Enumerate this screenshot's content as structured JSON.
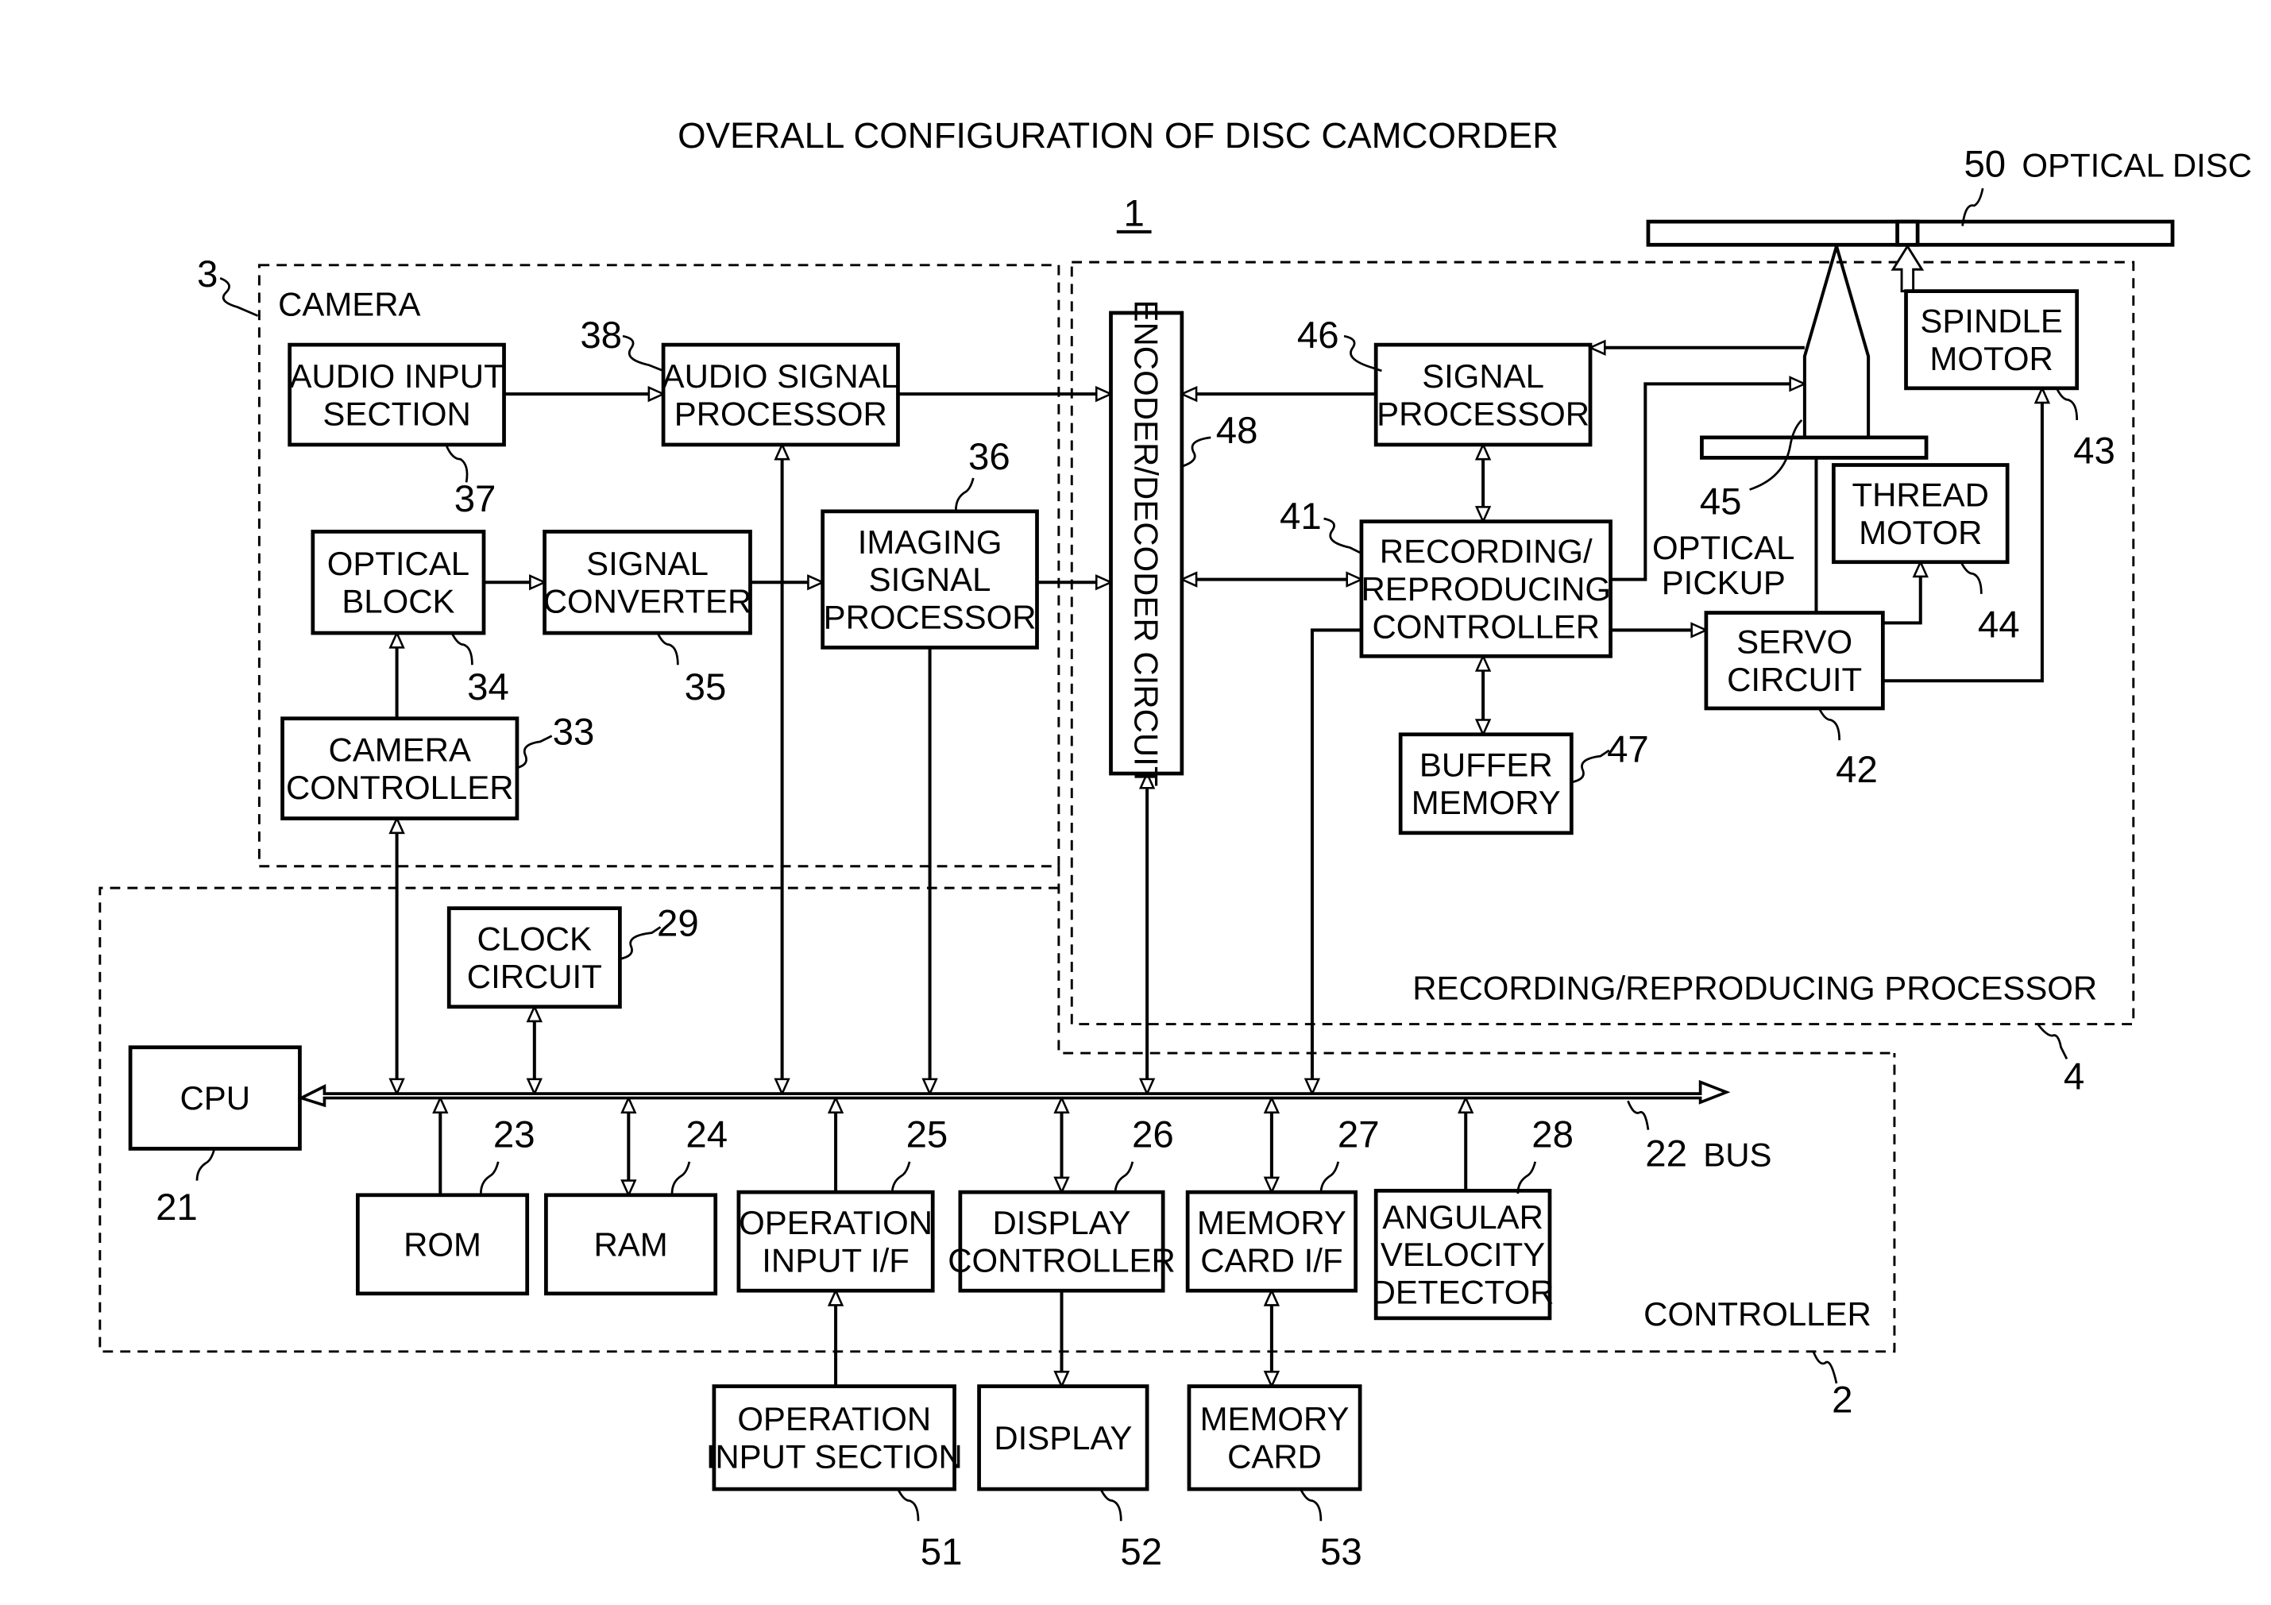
{
  "title": "OVERALL CONFIGURATION OF DISC CAMCORDER",
  "figure_ref": "1",
  "groups": {
    "camera": {
      "ref": "3",
      "label": "CAMERA"
    },
    "recorder": {
      "ref": "4",
      "label": "RECORDING/REPRODUCING PROCESSOR"
    },
    "controller": {
      "ref": "2",
      "label": "CONTROLLER"
    }
  },
  "blocks": {
    "audio_input": {
      "ref": "37",
      "lines": [
        "AUDIO INPUT",
        "SECTION"
      ]
    },
    "audio_signal": {
      "ref": "38",
      "lines": [
        "AUDIO SIGNAL",
        "PROCESSOR"
      ]
    },
    "optical_block": {
      "ref": "34",
      "lines": [
        "OPTICAL",
        "BLOCK"
      ]
    },
    "signal_converter": {
      "ref": "35",
      "lines": [
        "SIGNAL",
        "CONVERTER"
      ]
    },
    "imaging_signal": {
      "ref": "36",
      "lines": [
        "IMAGING",
        "SIGNAL",
        "PROCESSOR"
      ]
    },
    "camera_controller": {
      "ref": "33",
      "lines": [
        "CAMERA",
        "CONTROLLER"
      ]
    },
    "encoder_decoder": {
      "ref": "48",
      "lines": [
        "ENCODER/DECODER CIRCUIT"
      ]
    },
    "signal_processor": {
      "ref": "46",
      "lines": [
        "SIGNAL",
        "PROCESSOR"
      ]
    },
    "rec_rep_controller": {
      "ref": "41",
      "lines": [
        "RECORDING/",
        "REPRODUCING",
        "CONTROLLER"
      ]
    },
    "buffer_memory": {
      "ref": "47",
      "lines": [
        "BUFFER",
        "MEMORY"
      ]
    },
    "servo_circuit": {
      "ref": "42",
      "lines": [
        "SERVO",
        "CIRCUIT"
      ]
    },
    "spindle_motor": {
      "ref": "43",
      "lines": [
        "SPINDLE",
        "MOTOR"
      ]
    },
    "thread_motor": {
      "ref": "44",
      "lines": [
        "THREAD",
        "MOTOR"
      ]
    },
    "optical_pickup": {
      "ref": "45",
      "lines": [
        "OPTICAL",
        "PICKUP"
      ]
    },
    "optical_disc": {
      "ref": "50",
      "label": "OPTICAL DISC"
    },
    "clock_circuit": {
      "ref": "29",
      "lines": [
        "CLOCK",
        "CIRCUIT"
      ]
    },
    "cpu": {
      "ref": "21",
      "lines": [
        "CPU"
      ]
    },
    "rom": {
      "ref": "23",
      "lines": [
        "ROM"
      ]
    },
    "ram": {
      "ref": "24",
      "lines": [
        "RAM"
      ]
    },
    "operation_input_if": {
      "ref": "25",
      "lines": [
        "OPERATION",
        "INPUT I/F"
      ]
    },
    "display_controller": {
      "ref": "26",
      "lines": [
        "DISPLAY",
        "CONTROLLER"
      ]
    },
    "memory_card_if": {
      "ref": "27",
      "lines": [
        "MEMORY",
        "CARD I/F"
      ]
    },
    "angular_velocity": {
      "ref": "28",
      "lines": [
        "ANGULAR",
        "VELOCITY",
        "DETECTOR"
      ]
    },
    "operation_input_section": {
      "ref": "51",
      "lines": [
        "OPERATION",
        "INPUT SECTION"
      ]
    },
    "display": {
      "ref": "52",
      "lines": [
        "DISPLAY"
      ]
    },
    "memory_card": {
      "ref": "53",
      "lines": [
        "MEMORY",
        "CARD"
      ]
    }
  },
  "bus": {
    "ref": "22",
    "label": "BUS"
  }
}
